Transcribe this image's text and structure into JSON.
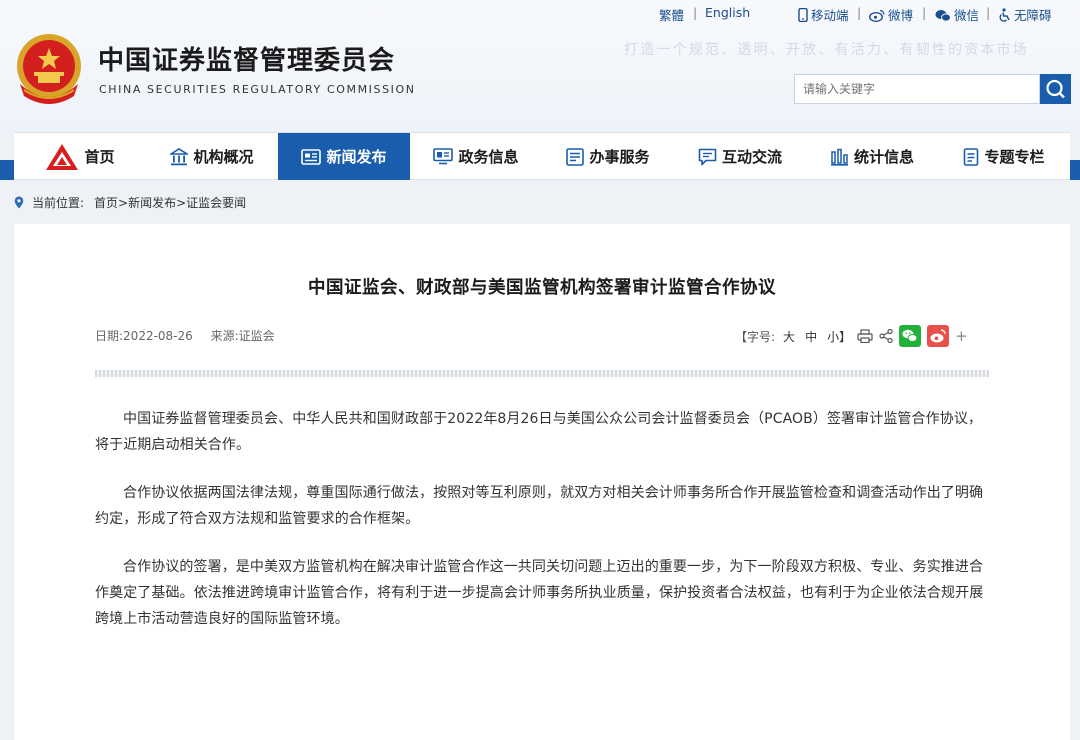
{
  "top_links": {
    "traditional": "繁體",
    "english": "English",
    "mobile": "移动端",
    "weibo": "微博",
    "wechat": "微信",
    "accessibility": "无障碍"
  },
  "site": {
    "title_cn": "中国证券监督管理委员会",
    "title_en": "CHINA SECURITIES REGULATORY COMMISSION",
    "slogan": "打造一个规范、透明、开放、有活力、有韧性的资本市场"
  },
  "search": {
    "placeholder": "请输入关键字"
  },
  "nav": {
    "items": [
      {
        "label": "首页",
        "icon": "csrc-logo-icon"
      },
      {
        "label": "机构概况",
        "icon": "institution-icon"
      },
      {
        "label": "新闻发布",
        "icon": "news-icon"
      },
      {
        "label": "政务信息",
        "icon": "monitor-icon"
      },
      {
        "label": "办事服务",
        "icon": "service-list-icon"
      },
      {
        "label": "互动交流",
        "icon": "chat-icon"
      },
      {
        "label": "统计信息",
        "icon": "bar-chart-icon"
      },
      {
        "label": "专题专栏",
        "icon": "document-icon"
      }
    ],
    "active_index": 2,
    "active_color": "#1a5dac"
  },
  "breadcrumb": {
    "prefix": "当前位置:",
    "path": "首页>新闻发布>证监会要闻"
  },
  "article": {
    "title": "中国证监会、财政部与美国监管机构签署审计监管合作协议",
    "date": "日期:2022-08-26",
    "source": "来源:证监会",
    "font_label": "【字号:",
    "font_large": "大",
    "font_medium": "中",
    "font_small": "小】",
    "plus": "+",
    "paragraphs": [
      "中国证券监督管理委员会、中华人民共和国财政部于2022年8月26日与美国公众公司会计监督委员会（PCAOB）签署审计监管合作协议，将于近期启动相关合作。",
      "合作协议依据两国法律法规，尊重国际通行做法，按照对等互利原则，就双方对相关会计师事务所合作开展监管检查和调查活动作出了明确约定，形成了符合双方法规和监管要求的合作框架。",
      "合作协议的签署，是中美双方监管机构在解决审计监管合作这一共同关切问题上迈出的重要一步，为下一阶段双方积极、专业、务实推进合作奠定了基础。依法推进跨境审计监管合作，将有利于进一步提高会计师事务所执业质量，保护投资者合法权益，也有利于为企业依法合规开展跨境上市活动营造良好的国际监管环境。"
    ]
  }
}
